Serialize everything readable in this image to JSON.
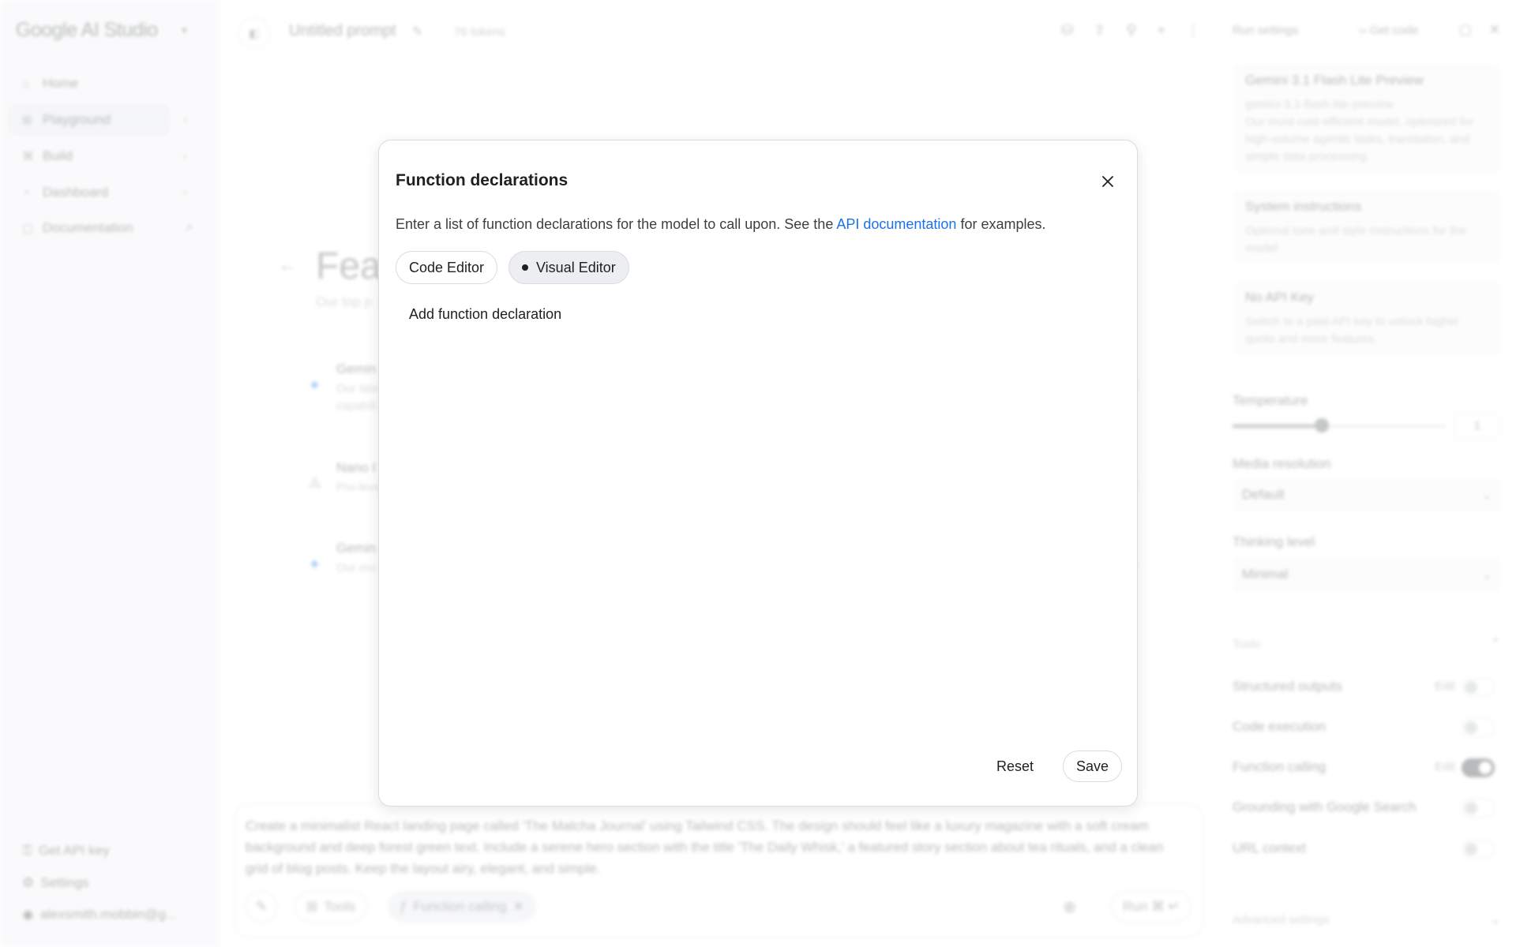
{
  "sidebar": {
    "brand": "Google AI Studio",
    "items": [
      {
        "label": "Home",
        "icon": "home-icon"
      },
      {
        "label": "Playground",
        "icon": "playground-icon"
      },
      {
        "label": "Build",
        "icon": "build-icon"
      },
      {
        "label": "Dashboard",
        "icon": "dashboard-icon"
      },
      {
        "label": "Documentation",
        "icon": "documentation-icon"
      }
    ],
    "bottom": [
      {
        "label": "Get API key",
        "icon": "key-icon"
      },
      {
        "label": "Settings",
        "icon": "gear-icon"
      },
      {
        "label": "alexsmith.mobbin@g...",
        "icon": "account-icon"
      }
    ]
  },
  "header": {
    "title": "Untitled prompt",
    "tokens": "76 tokens"
  },
  "main": {
    "featured_title": "Feat",
    "featured_subtitle": "Our top p",
    "rows": [
      {
        "name": "Gemin",
        "desc": "Our late\ncapabili"
      },
      {
        "name": "Nano I",
        "desc": "Pro-leve"
      },
      {
        "name": "Gemin",
        "desc": "Our mo"
      }
    ]
  },
  "prompt": {
    "text": "Create a minimalist React landing page called 'The Matcha Journal' using Tailwind CSS. The design should feel like a luxury magazine with a soft cream background and deep forest green text. Include a serene hero section with the title 'The Daily Whisk,' a featured story section about tea rituals, and a clean grid of blog posts. Keep the layout airy, elegant, and simple.",
    "tools_label": "Tools",
    "function_calling_label": "Function calling",
    "run_label": "Run ⌘ ↵"
  },
  "run_settings": {
    "title": "Run settings",
    "get_code": "Get code",
    "model": {
      "name": "Gemini 3.1 Flash Lite Preview",
      "id": "gemini-3.1-flash-lite-preview",
      "description": "Our most cost-efficient model, optimized for high-volume agentic tasks, translation, and simple data processing."
    },
    "system_instructions": {
      "title": "System instructions",
      "placeholder": "Optional tone and style instructions for the model"
    },
    "api_key": {
      "title": "No API Key",
      "description": "Switch to a paid API key to unlock higher quota and more features."
    },
    "temperature_label": "Temperature",
    "temperature_value": "1",
    "temperature_fraction": 0.5,
    "media_resolution_label": "Media resolution",
    "media_resolution_value": "Default",
    "thinking_level_label": "Thinking level",
    "thinking_level_value": "Minimal",
    "tools_label": "Tools",
    "tools": [
      {
        "label": "Structured outputs",
        "edit": "Edit",
        "enabled": false
      },
      {
        "label": "Code execution",
        "edit": "",
        "enabled": false
      },
      {
        "label": "Function calling",
        "edit": "Edit",
        "enabled": true
      },
      {
        "label": "Grounding with Google Search",
        "edit": "",
        "enabled": false
      },
      {
        "label": "URL context",
        "edit": "",
        "enabled": false
      }
    ],
    "advanced_label": "Advanced settings"
  },
  "modal": {
    "title": "Function declarations",
    "description_prefix": "Enter a list of function declarations for the model to call upon. See the ",
    "description_link": "API documentation",
    "description_suffix": " for examples.",
    "tabs": {
      "code_editor": "Code Editor",
      "visual_editor": "Visual Editor"
    },
    "active_tab": "Visual Editor",
    "add_declaration": "Add function declaration",
    "reset_label": "Reset",
    "save_label": "Save"
  },
  "colors": {
    "accent_link": "#1a73e8",
    "text": "#1f1f1f",
    "border": "#dadce0"
  }
}
